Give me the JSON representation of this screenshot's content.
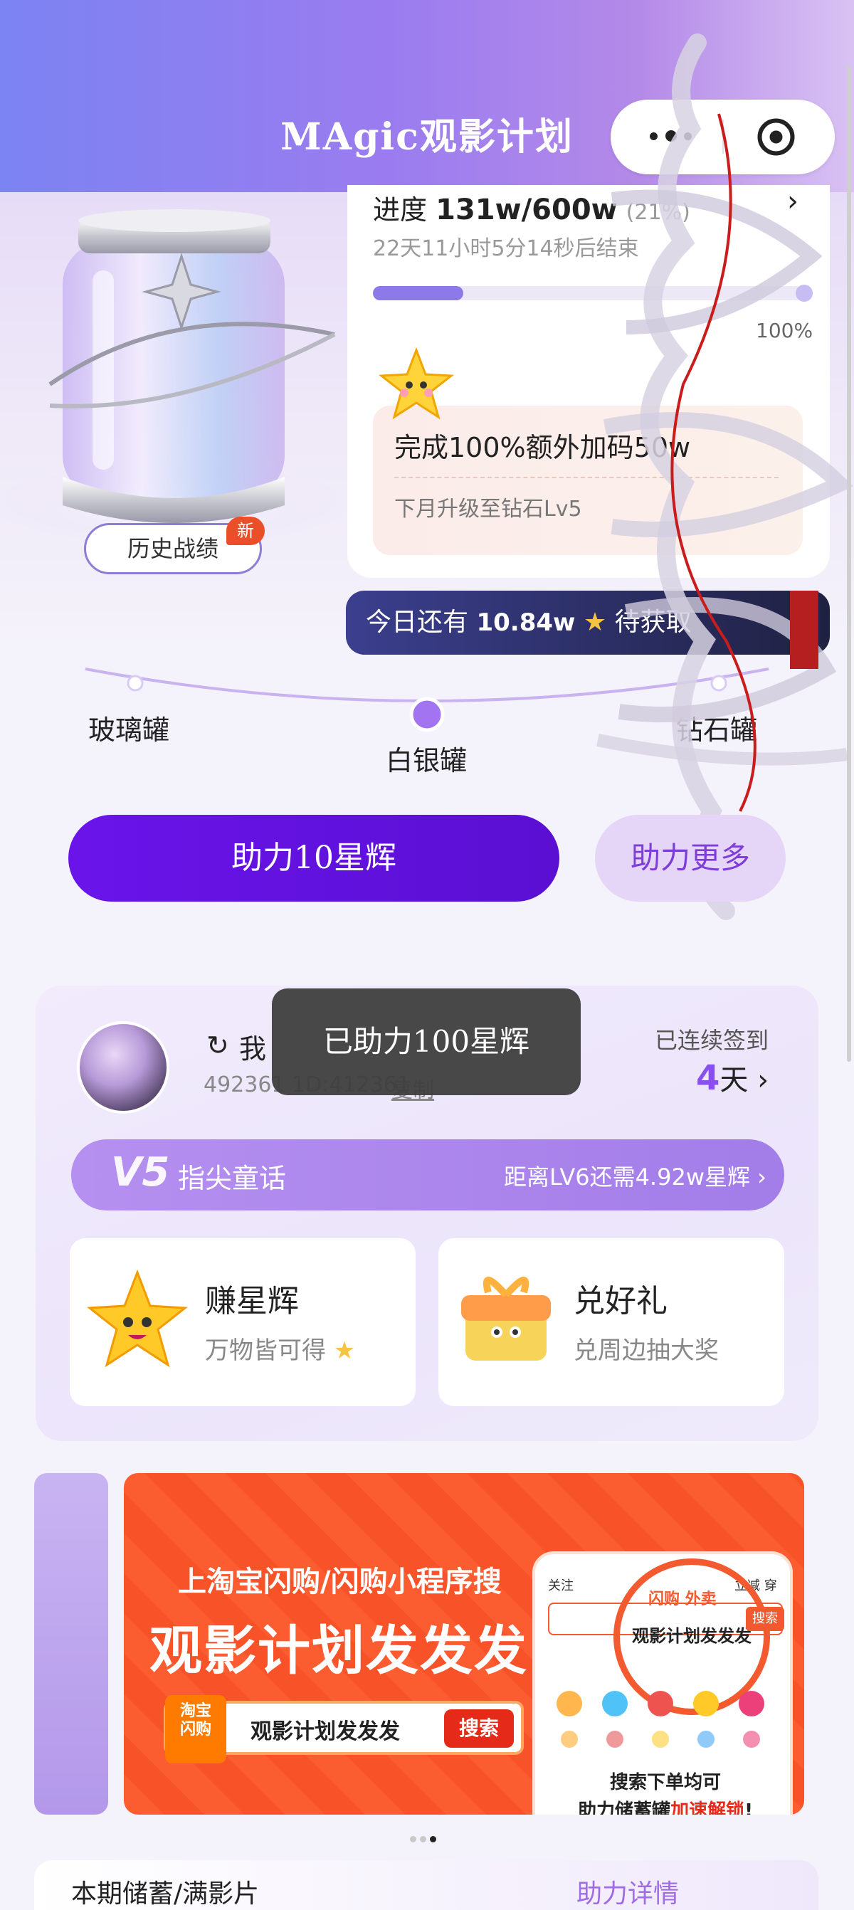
{
  "header": {
    "title": "MAgic观影计划"
  },
  "capsule": {
    "more_icon": "more-dots-icon",
    "close_icon": "target-circle-icon"
  },
  "jar": {
    "history_label": "历史战绩",
    "new_badge": "新"
  },
  "progress": {
    "label_prefix": "进度",
    "current": "131w",
    "separator": "/",
    "target": "600w",
    "percent_text": "(21%)",
    "percent_value": 21,
    "countdown": "22天11小时5分14秒后结束",
    "end_label": "100%",
    "bonus_title": "完成100%额外加码50w",
    "bonus_sub": "下月升级至钻石Lv5"
  },
  "today": {
    "prefix": "今日还有",
    "amount": "10.84w",
    "suffix": "待获取"
  },
  "levels": [
    {
      "label": "玻璃罐"
    },
    {
      "label": "白银罐"
    },
    {
      "label": "钻石罐"
    }
  ],
  "actions": {
    "boost_label": "助力10星辉",
    "more_label": "助力更多"
  },
  "user": {
    "name_partial": "我",
    "id_partial": "492361 1D:412361",
    "id_action": "复制",
    "streak_label": "已连续签到",
    "streak_days": "4",
    "streak_unit": "天",
    "vip_level": "V5",
    "vip_name": "指尖童话",
    "vip_next": "距离LV6还需4.92w星辉"
  },
  "tasks": [
    {
      "title": "赚星辉",
      "subtitle": "万物皆可得",
      "icon": "star-mascot-icon"
    },
    {
      "title": "兑好礼",
      "subtitle": "兑周边抽大奖",
      "icon": "gift-box-icon"
    }
  ],
  "toast": {
    "text": "已助力100星辉"
  },
  "banner": {
    "line1": "上淘宝闪购/闪购小程序搜",
    "line2": "观影计划发发发",
    "search_logo_1": "淘宝",
    "search_logo_2": "闪购",
    "search_text": "观影计划发发发",
    "search_button": "搜索",
    "phone_tabs": "关注",
    "phone_tab_right": "立减 穿",
    "phone_tag": "闪购 外卖",
    "phone_query": "观影计划发发发",
    "phone_search_btn": "搜索",
    "phone_footer1": "搜索下单均可",
    "phone_footer2_a": "助力储蓄罐",
    "phone_footer2_b": "加速解锁",
    "phone_footer2_c": "!"
  },
  "pager": {
    "count": 3,
    "active": 2
  },
  "bottom": {
    "left": "本期储蓄/满影片",
    "right": "助力详情"
  },
  "colors": {
    "primary": "#6a14ea",
    "accent": "#8a4ff0",
    "orange": "#fb5c30"
  }
}
